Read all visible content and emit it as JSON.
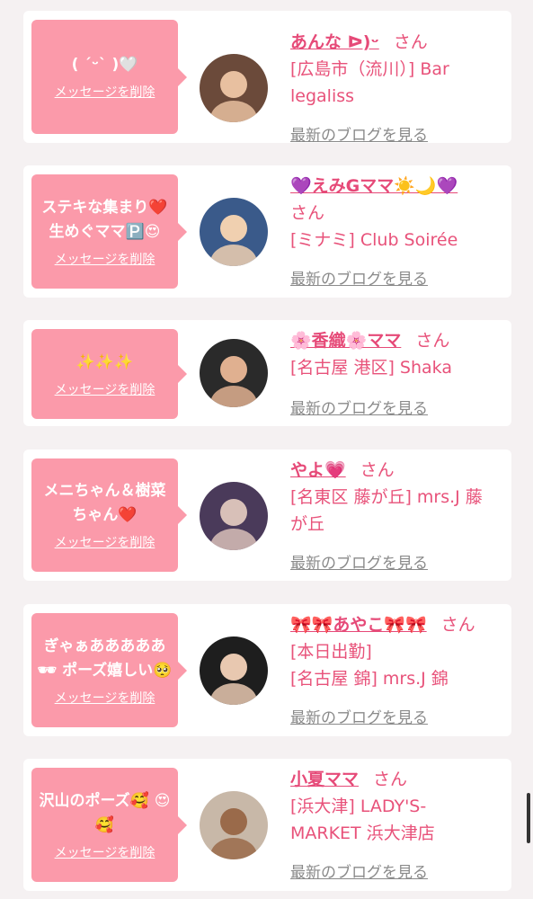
{
  "common": {
    "delete_label": "メッセージを削除",
    "blog_label": "最新のブログを見る",
    "honorific": "さん"
  },
  "colors": {
    "bubble": "#fb9aaa",
    "name": "#e64a78",
    "text": "#e8527a",
    "blog": "#8a8a8a",
    "background": "#f5f1f2"
  },
  "entries": [
    {
      "message": "( ˊᵕˋ )🤍",
      "name": "あんな ᐅ)ᵕ",
      "shop_lines": [
        "[広島市（流川）] Bar",
        "legaliss"
      ]
    },
    {
      "message": "ステキな集まり❤️ 生めぐママ🅿️😍",
      "name": "💜えみGママ☀️🌙💜",
      "shop_lines": [
        "[ミナミ] Club Soirée"
      ]
    },
    {
      "message": "✨✨✨",
      "name": "🌸香織🌸ママ",
      "shop_lines": [
        "[名古屋 港区] Shaka"
      ]
    },
    {
      "message": "メニちゃん＆樹菜ちゃん❤️",
      "name": "やよ💗",
      "shop_lines": [
        "[名東区 藤が丘] mrs.J 藤",
        "が丘"
      ]
    },
    {
      "message": "ぎゃぁあああああ🕶 ポーズ嬉しい🥺",
      "name": "🎀🎀あやこ🎀🎀",
      "shop_lines": [
        "[本日出勤]",
        "[名古屋 錦] mrs.J 錦"
      ]
    },
    {
      "message": "沢山のポーズ🥰 😍🥰",
      "name": "小夏ママ",
      "shop_lines": [
        "[浜大津] LADY'S-",
        "MARKET 浜大津店"
      ]
    }
  ]
}
